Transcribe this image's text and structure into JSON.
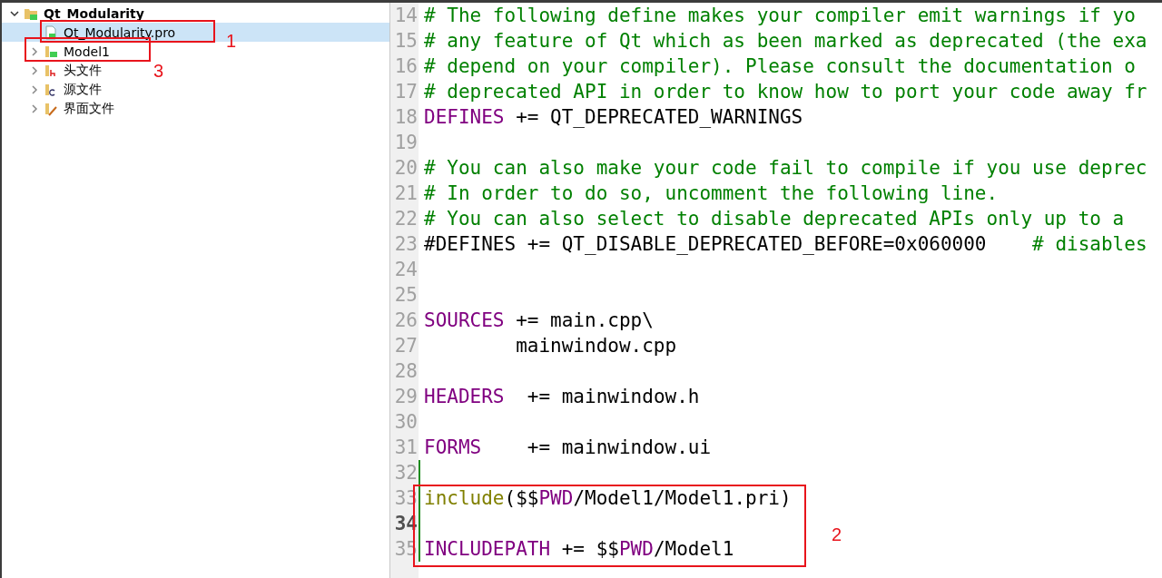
{
  "project_tree": {
    "root": {
      "label": "Qt_Modularity",
      "expanded": true,
      "children": [
        {
          "label": "Qt_Modularity.pro",
          "kind": "pro-file",
          "selected": true
        },
        {
          "label": "Model1",
          "kind": "qt-folder",
          "expanded": false,
          "selected": false
        },
        {
          "label": "头文件",
          "kind": "header-folder",
          "expanded": false,
          "selected": false
        },
        {
          "label": "源文件",
          "kind": "source-folder",
          "expanded": false,
          "selected": false
        },
        {
          "label": "界面文件",
          "kind": "form-folder",
          "expanded": false,
          "selected": false
        }
      ]
    }
  },
  "editor": {
    "lines": [
      {
        "number": "14",
        "current": false,
        "modified": false,
        "tokens": [
          {
            "kind": "comment",
            "text": "# The following define makes your compiler emit warnings if yo"
          }
        ]
      },
      {
        "number": "15",
        "current": false,
        "modified": false,
        "tokens": [
          {
            "kind": "comment",
            "text": "# any feature of Qt which as been marked as deprecated (the exa"
          }
        ]
      },
      {
        "number": "16",
        "current": false,
        "modified": false,
        "tokens": [
          {
            "kind": "comment",
            "text": "# depend on your compiler). Please consult the documentation o"
          }
        ]
      },
      {
        "number": "17",
        "current": false,
        "modified": false,
        "tokens": [
          {
            "kind": "comment",
            "text": "# deprecated API in order to know how to port your code away fr"
          }
        ]
      },
      {
        "number": "18",
        "current": false,
        "modified": false,
        "tokens": [
          {
            "kind": "keyword",
            "text": "DEFINES"
          },
          {
            "kind": "plain",
            "text": " += QT_DEPRECATED_WARNINGS"
          }
        ]
      },
      {
        "number": "19",
        "current": false,
        "modified": false
      },
      {
        "number": "20",
        "current": false,
        "modified": false,
        "tokens": [
          {
            "kind": "comment",
            "text": "# You can also make your code fail to compile if you use deprec"
          }
        ]
      },
      {
        "number": "21",
        "current": false,
        "modified": false,
        "tokens": [
          {
            "kind": "comment",
            "text": "# In order to do so, uncomment the following line."
          }
        ]
      },
      {
        "number": "22",
        "current": false,
        "modified": false,
        "tokens": [
          {
            "kind": "comment",
            "text": "# You can also select to disable deprecated APIs only up to a"
          }
        ]
      },
      {
        "number": "23",
        "current": false,
        "modified": false,
        "tokens": [
          {
            "kind": "plain",
            "text": "#DEFINES += QT_DISABLE_DEPRECATED_BEFORE=0x060000    "
          },
          {
            "kind": "comment",
            "text": "# disables"
          }
        ]
      },
      {
        "number": "24",
        "current": false,
        "modified": false
      },
      {
        "number": "25",
        "current": false,
        "modified": false
      },
      {
        "number": "26",
        "current": false,
        "modified": false,
        "tokens": [
          {
            "kind": "keyword",
            "text": "SOURCES"
          },
          {
            "kind": "plain",
            "text": " += main.cpp\\"
          }
        ]
      },
      {
        "number": "27",
        "current": false,
        "modified": false,
        "tokens": [
          {
            "kind": "plain",
            "text": "        mainwindow.cpp"
          }
        ]
      },
      {
        "number": "28",
        "current": false,
        "modified": false
      },
      {
        "number": "29",
        "current": false,
        "modified": false,
        "tokens": [
          {
            "kind": "keyword",
            "text": "HEADERS"
          },
          {
            "kind": "plain",
            "text": "  += mainwindow.h"
          }
        ]
      },
      {
        "number": "30",
        "current": false,
        "modified": false
      },
      {
        "number": "31",
        "current": false,
        "modified": false,
        "tokens": [
          {
            "kind": "keyword",
            "text": "FORMS"
          },
          {
            "kind": "plain",
            "text": "    += mainwindow.ui"
          }
        ]
      },
      {
        "number": "32",
        "current": false,
        "modified": true
      },
      {
        "number": "33",
        "current": false,
        "modified": true,
        "tokens": [
          {
            "kind": "function",
            "text": "include"
          },
          {
            "kind": "plain",
            "text": "($$"
          },
          {
            "kind": "keyword",
            "text": "PWD"
          },
          {
            "kind": "plain",
            "text": "/Model1/Model1.pri)"
          }
        ]
      },
      {
        "number": "34",
        "current": true,
        "modified": true
      },
      {
        "number": "35",
        "current": false,
        "modified": true,
        "tokens": [
          {
            "kind": "keyword",
            "text": "INCLUDEPATH"
          },
          {
            "kind": "plain",
            "text": " += $$"
          },
          {
            "kind": "keyword",
            "text": "PWD"
          },
          {
            "kind": "plain",
            "text": "/Model1"
          }
        ]
      }
    ]
  },
  "annotations": [
    {
      "label": "1"
    },
    {
      "label": "3"
    },
    {
      "label": "2"
    }
  ]
}
